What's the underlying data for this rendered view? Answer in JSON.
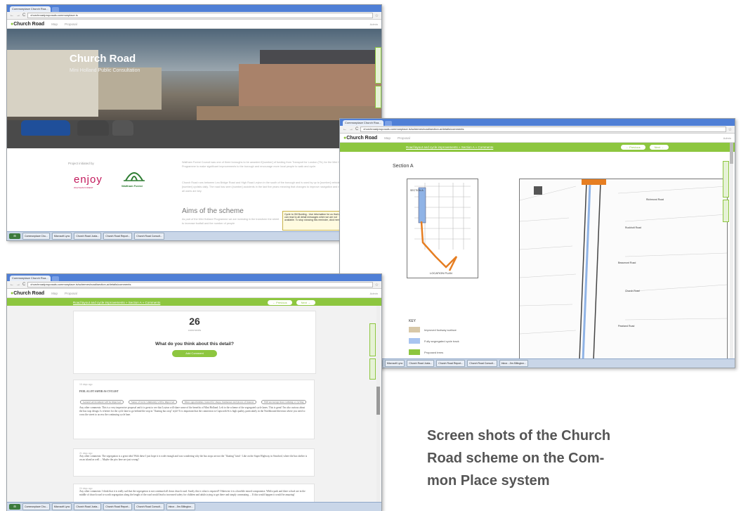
{
  "shared": {
    "tab_title": "Commonplace Church Roa...",
    "site_name": "Church Road",
    "nav": [
      "Map",
      "Proposal"
    ],
    "admin": "Admin",
    "back": "←",
    "fwd": "→",
    "reload": "C",
    "star": "☆"
  },
  "shot1": {
    "url": "churchroadproposals.commonplace.is",
    "hero_title": "Church Road",
    "hero_subtitle": "Mini Holland Public Consultation",
    "funded_by": "Project initiated by",
    "enjoy_logo": "enjoy",
    "enjoy_sub": "WALTHAM FOREST",
    "waltham_logo": "Waltham Forest",
    "para1": "Waltham Forest Council was one of three boroughs to be awarded £[number] of funding from Transport for London (TfL) for the Mini Holland Programme to make significant improvements to the borough and encourage more local people to walk and cycle.",
    "para2": "Church Road runs between Lea Bridge Road and High Road Leyton in the south of the borough and is used by up to [number] vehicles and [number] cyclists daily. The road has seen [number] accidents in the last five years meaning that changes to improve navigation and road safety for all users are key.",
    "aims_title": "Aims of the scheme",
    "aims_text": "As part of the Mini Holland Programme we are investing in the transform the street to increase footfall and the number of people",
    "popup": "Cycle to Gill Bunting - Use information for us that we can read to all detail messages when we are not available. To stop showing this reminder, click here"
  },
  "shot2": {
    "url": "churchroadproposals.commonplace.is/schemes/road/section-a/details/comments",
    "breadcrumb": "Road layout and cycle improvements » Section A » Comments",
    "prev_btn": "← Previous",
    "next_btn": "Next →",
    "section_title": "Section A",
    "section_label": "SECTION A",
    "location_plan": "LOCATION PLAN",
    "map_labels": [
      "Richmond Road",
      "Ruckholt Road",
      "Beaumont Road",
      "Church Road",
      "Pearland Road"
    ],
    "key_title": "KEY",
    "key_items": [
      "Improved footway surface",
      "Fully segregated cycle track",
      "Proposed trees"
    ]
  },
  "shot3": {
    "url": "churchroadproposals.commonplace.is/schemes/road/section-a/details/comments",
    "breadcrumb": "Road layout and cycle improvements » Section A » Comments",
    "prev_btn": "← Previous",
    "next_btn": "Next →",
    "count": "26",
    "count_label": "comments",
    "question": "What do you think about this detail?",
    "add_comment": "Add Comment",
    "comment1_time": "15 days ago",
    "comment1_head": "FEEL A LOT SAFER AS CYCLIST",
    "comment1_tags": [
      "General environment will be improved",
      "Sense of local community will be improved",
      "More opportunities created for shops, businesses and places of interest",
      "Will encourage more walking or cycling"
    ],
    "comment1_text": "Any other comments: This is a very impressive proposal and it is great to see that Leyton will share some of the benefits of Mini Holland. Left to the scheme of the segregated cycle lanes. This is great! I'm also curious about the bus stop design. Is it better for the cycle lane to go behind the stop in \"floating bus stop\" style? It is important that the connection to Capworth St is high quality, particularly in the Northbound direction where you need to cross the street to access the continuing cycle lane.",
    "comment2_time": "21 days ago",
    "comment2_text": "Any other comments: The segregation is a great idea! With these I just hope it is wide enough and was wondering why the bus stops are not the \"floating\" kind - Like on the Super Highway in Stratford, where the bus shelter is on an island as well ... Maybe the pics here are just wrong?",
    "comment3_time": "24 days ago",
    "comment3_text": "Any other comments: I think that it is really sad that the segregation is not continued all down church road. Surely this is what is required? Otherwise it is a horrible mixed compromise. Whilst park and there school are in the middle of church road to worth segregation along the length of the road would lead to increased safety for children and adults trying to get there and simply commuting ... If this would happen it would be amazing!",
    "taskbar": [
      "Commonplace Chu...",
      "Microsoft Lync",
      "Church Road Juxta...",
      "Church Road Report...",
      "Church Road Consult...",
      "Inbox - Jim.Sillington..."
    ]
  },
  "taskbar1": [
    "Commonplace Chu...",
    "Microsoft Lync",
    "Church Road Juxta...",
    "Church Road Report...",
    "Church Road Consult..."
  ],
  "caption": {
    "line1": "Screen shots of the Church",
    "line2": "Road scheme on the Com-",
    "line3": "mon Place system"
  },
  "colors": {
    "accent": "#8dc63f",
    "caption": "#555555",
    "enjoy": "#c2185b",
    "waltham": "#2e7d32"
  }
}
